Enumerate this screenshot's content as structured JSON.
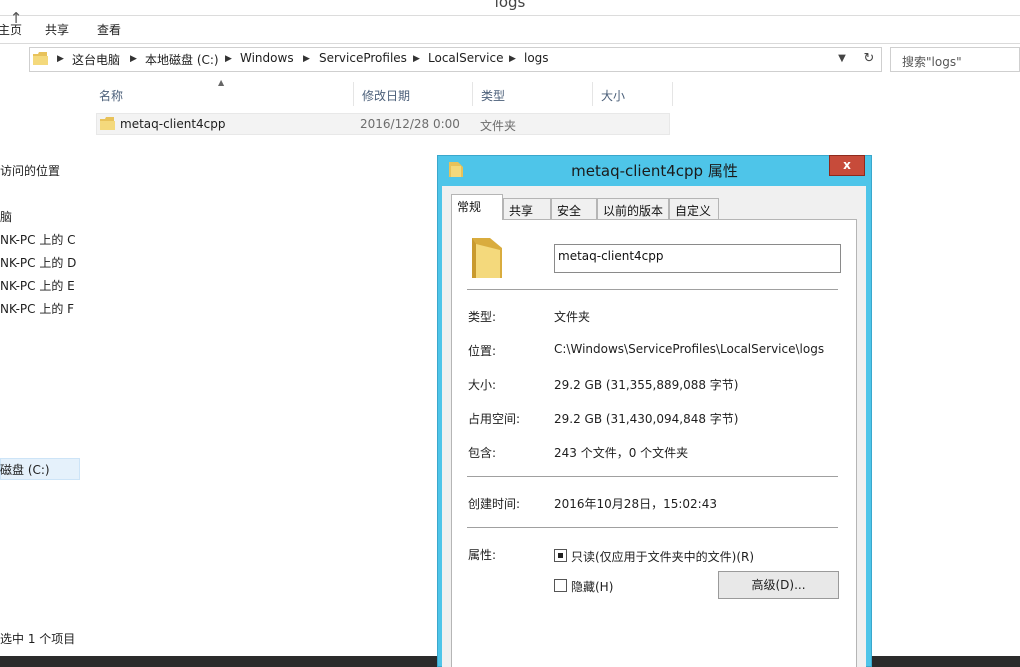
{
  "window": {
    "title": "logs"
  },
  "ribbon": {
    "tabs": [
      "主页",
      "共享",
      "查看"
    ]
  },
  "address": {
    "crumbs": [
      "这台电脑",
      "本地磁盘 (C:)",
      "Windows",
      "ServiceProfiles",
      "LocalService",
      "logs"
    ]
  },
  "search": {
    "placeholder": "搜索\"logs\""
  },
  "navpane": {
    "items": [
      "访问的位置",
      "脑",
      "NK-PC 上的 C",
      "NK-PC 上的 D",
      "NK-PC 上的 E",
      "NK-PC 上的 F",
      "磁盘 (C:)"
    ]
  },
  "filelist": {
    "columns": [
      "名称",
      "修改日期",
      "类型",
      "大小"
    ],
    "rows": [
      {
        "name": "metaq-client4cpp",
        "modified": "2016/12/28 0:00",
        "type": "文件夹",
        "size": ""
      }
    ]
  },
  "status": {
    "text": "选中 1 个项目"
  },
  "dialog": {
    "title": "metaq-client4cpp 属性",
    "close": "x",
    "tabs": [
      "常规",
      "共享",
      "安全",
      "以前的版本",
      "自定义"
    ],
    "name_value": "metaq-client4cpp",
    "props": {
      "type_label": "类型:",
      "type_value": "文件夹",
      "location_label": "位置:",
      "location_value": "C:\\Windows\\ServiceProfiles\\LocalService\\logs",
      "size_label": "大小:",
      "size_value": "29.2 GB (31,355,889,088 字节)",
      "disk_label": "占用空间:",
      "disk_value": "29.2 GB (31,430,094,848 字节)",
      "contains_label": "包含:",
      "contains_value": "243 个文件，0 个文件夹",
      "created_label": "创建时间:",
      "created_value": "2016年10月28日，15:02:43",
      "attr_label": "属性:",
      "readonly_label": "只读(仅应用于文件夹中的文件)(R)",
      "hidden_label": "隐藏(H)",
      "advanced_label": "高级(D)..."
    }
  },
  "icons": {
    "folder": "folder-icon",
    "accent": "#4ec5e9",
    "close_bg": "#c74b3a"
  }
}
